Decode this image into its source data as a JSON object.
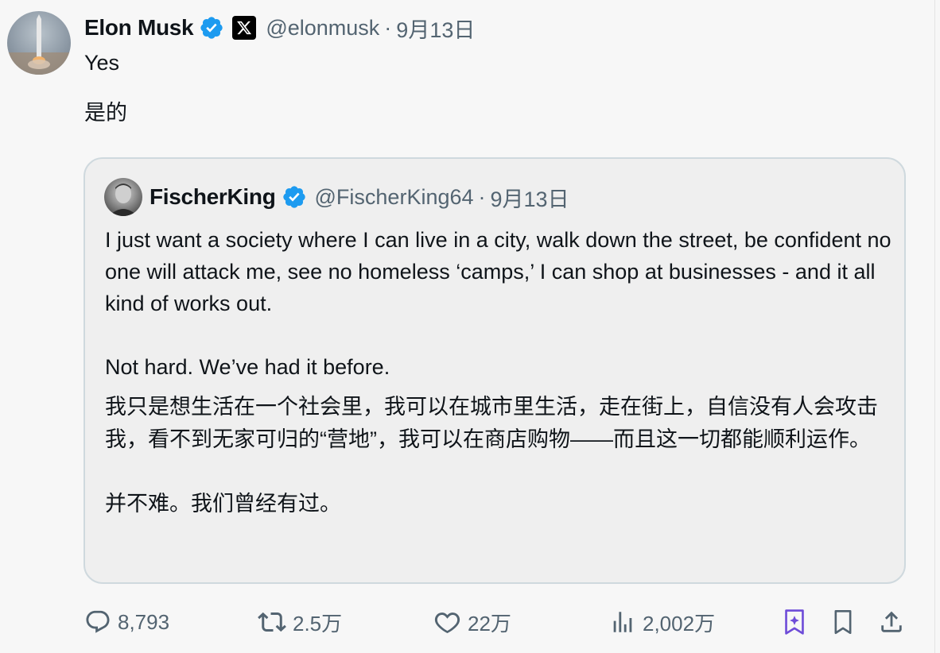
{
  "tweet": {
    "author_name": "Elon Musk",
    "handle": "@elonmusk",
    "separator": "·",
    "date": "9月13日",
    "text_en": "Yes",
    "text_zh": "是的"
  },
  "quoted": {
    "author_name": "FischerKing",
    "handle": "@FischerKing64",
    "separator": "·",
    "date": "9月13日",
    "p1": "I just want a society where I can live in a city, walk down the street, be confident no one will attack me, see no homeless ‘camps,’ I can shop at businesses - and it all kind of works out.",
    "p2": "Not hard. We’ve had it before.",
    "p3": "我只是想生活在一个社会里，我可以在城市里生活，走在街上，自信没有人会攻击我，看不到无家可归的“营地”，我可以在商店购物——而且这一切都能顺利运作。",
    "p4": "并不难。我们曾经有过。"
  },
  "actions": {
    "replies": "8,793",
    "reposts": "2.5万",
    "likes": "22万",
    "views": "2,002万"
  },
  "colors": {
    "verified": "#1d9bf0",
    "muted": "#536471",
    "text": "#0f1419",
    "border": "#cfd9de",
    "grok": "#6e4cd8"
  },
  "icons": [
    "verified-badge-icon",
    "x-logo-icon",
    "reply-icon",
    "repost-icon",
    "like-icon",
    "views-icon",
    "grok-icon",
    "bookmark-icon",
    "share-icon"
  ]
}
